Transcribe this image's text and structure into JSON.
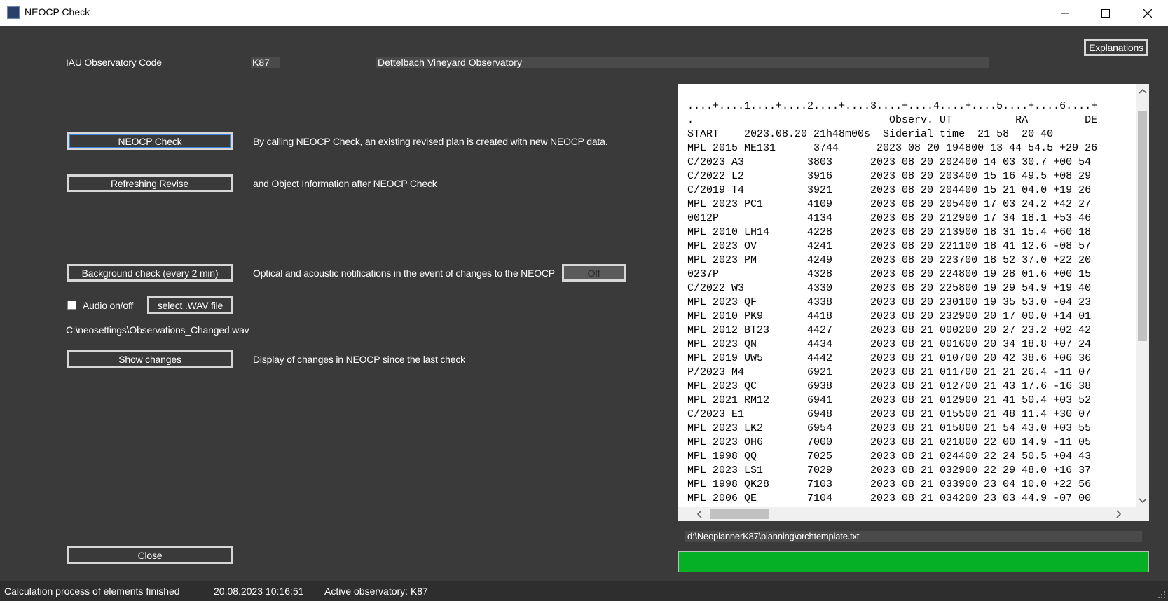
{
  "window": {
    "title": "NEOCP Check"
  },
  "observatory": {
    "label": "IAU Observatory Code",
    "code": "K87",
    "name": "Dettelbach Vineyard Observatory"
  },
  "buttons": {
    "explanations": "Explanations",
    "neocp_check": "NEOCP Check",
    "refreshing_revise": "Refreshing Revise",
    "background_check": "Background check (every 2 min)",
    "off": "Off",
    "select_wav": "select .WAV file",
    "show_changes": "Show changes",
    "close": "Close"
  },
  "descriptions": {
    "neocp_check": "By calling NEOCP Check, an existing revised plan is created with new NEOCP data.",
    "refreshing_revise": "and Object Information after NEOCP Check",
    "background_check": "Optical and acoustic notifications in the event of changes to the NEOCP",
    "show_changes": "Display of changes in NEOCP since the last check"
  },
  "audio": {
    "label": "Audio on/off",
    "checked": false,
    "wav_path": "C:\\neosettings\\Observations_Changed.wav"
  },
  "textview": {
    "lines": [
      "....+....1....+....2....+....3....+....4....+....5....+....6....+",
      ".                               Observ. UT          RA         DE",
      "START    2023.08.20 21h48m00s  Siderial time  21 58  20 40",
      "MPL 2015 ME131      3744      2023 08 20 194800 13 44 54.5 +29 26",
      "C/2023 A3          3803      2023 08 20 202400 14 03 30.7 +00 54",
      "C/2022 L2          3916      2023 08 20 203400 15 16 49.5 +08 29",
      "C/2019 T4          3921      2023 08 20 204400 15 21 04.0 +19 26",
      "MPL 2023 PC1       4109      2023 08 20 205400 17 03 24.2 +42 27",
      "0012P              4134      2023 08 20 212900 17 34 18.1 +53 46",
      "MPL 2010 LH14      4228      2023 08 20 213900 18 31 15.4 +60 18",
      "MPL 2023 OV        4241      2023 08 20 221100 18 41 12.6 -08 57",
      "MPL 2023 PM        4249      2023 08 20 223700 18 52 37.0 +22 20",
      "0237P              4328      2023 08 20 224800 19 28 01.6 +00 15",
      "C/2022 W3          4330      2023 08 20 225800 19 29 54.9 +19 40",
      "MPL 2023 QF        4338      2023 08 20 230100 19 35 53.0 -04 23",
      "MPL 2010 PK9       4418      2023 08 20 232900 20 17 00.0 +14 01",
      "MPL 2012 BT23      4427      2023 08 21 000200 20 27 23.2 +02 42",
      "MPL 2023 QN        4434      2023 08 21 001600 20 34 18.8 +07 24",
      "MPL 2019 UW5       4442      2023 08 21 010700 20 42 38.6 +06 36",
      "P/2023 M4          6921      2023 08 21 011700 21 21 26.4 -11 07",
      "MPL 2023 QC        6938      2023 08 21 012700 21 43 17.6 -16 38",
      "MPL 2021 RM12      6941      2023 08 21 012900 21 41 50.4 +03 52",
      "C/2023 E1          6948      2023 08 21 015500 21 48 11.4 +30 07",
      "MPL 2023 LK2       6954      2023 08 21 015800 21 54 43.0 +03 55",
      "MPL 2023 OH6       7000      2023 08 21 021800 22 00 14.9 -11 05",
      "MPL 1998 QQ        7025      2023 08 21 024400 22 24 50.5 +04 43",
      "MPL 2023 LS1       7029      2023 08 21 032900 22 29 48.0 +16 37",
      "MPL 1998 QK28      7103      2023 08 21 033900 23 04 10.0 +22 56",
      "MPL 2006 QE        7104      2023 08 21 034200 23 03 44.9 -07 00"
    ]
  },
  "template_path": "d:\\NeoplannerK87\\planning\\orchtemplate.txt",
  "progress": {
    "fraction": 1.0,
    "color": "#06b025"
  },
  "statusbar": {
    "message": "Calculation process of elements finished",
    "datetime": "20.08.2023 10:16:51",
    "active": "Active observatory: K87"
  }
}
